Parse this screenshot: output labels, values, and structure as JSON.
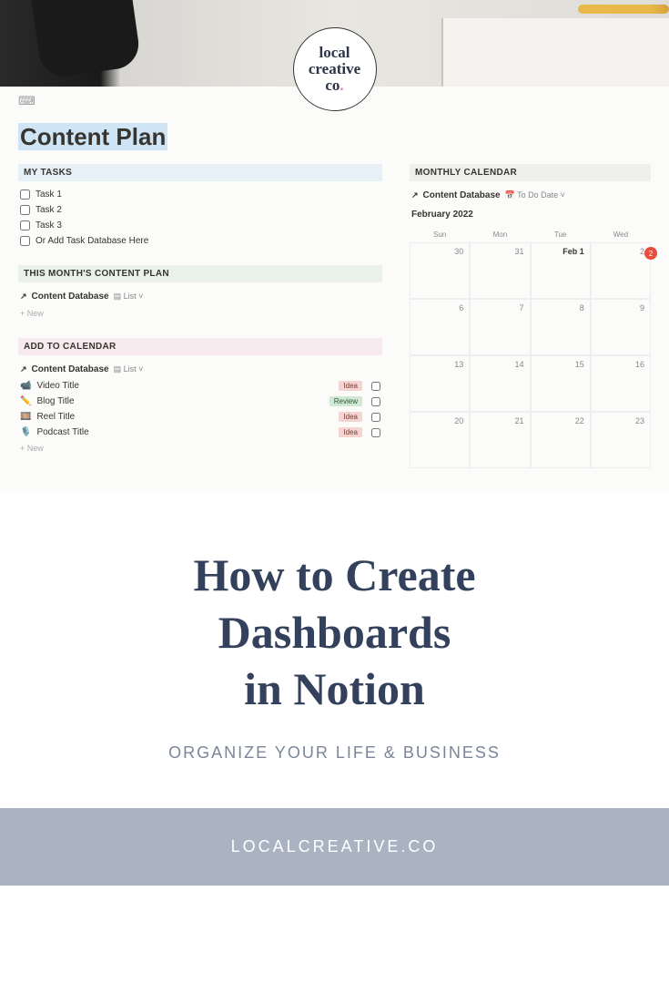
{
  "logo": {
    "l1": "local",
    "l2": "creative",
    "l3": "co"
  },
  "notion": {
    "title": "Content Plan",
    "tasks_header": "MY TASKS",
    "tasks": [
      "Task 1",
      "Task 2",
      "Task 3",
      "Or Add Task Database Here"
    ],
    "plan_header": "THIS MONTH'S CONTENT PLAN",
    "db_label": "Content Database",
    "list_view": "List",
    "new_label": "+  New",
    "add_header": "ADD TO CALENDAR",
    "items": [
      {
        "emoji": "📹",
        "title": "Video Title",
        "tag": "Idea",
        "tagClass": "tag-idea"
      },
      {
        "emoji": "✏️",
        "title": "Blog Title",
        "tag": "Review",
        "tagClass": "tag-review"
      },
      {
        "emoji": "🎞️",
        "title": "Reel Title",
        "tag": "Idea",
        "tagClass": "tag-idea"
      },
      {
        "emoji": "🎙️",
        "title": "Podcast Title",
        "tag": "Idea",
        "tagClass": "tag-idea"
      }
    ],
    "cal_header": "MONTHLY CALENDAR",
    "cal_view": "To Do Date",
    "cal_month": "February 2022",
    "cal_days": [
      "Sun",
      "Mon",
      "Tue",
      "Wed"
    ],
    "cal_cells": [
      [
        "30",
        "31",
        "Feb 1",
        "2"
      ],
      [
        "6",
        "7",
        "8",
        "9"
      ],
      [
        "13",
        "14",
        "15",
        "16"
      ],
      [
        "20",
        "21",
        "22",
        "23"
      ]
    ],
    "cal_badge": "2"
  },
  "headline": {
    "l1": "How to Create",
    "l2": "Dashboards",
    "l3": "in Notion"
  },
  "subhead": "ORGANIZE YOUR LIFE & BUSINESS",
  "footer": "LOCALCREATIVE.CO"
}
